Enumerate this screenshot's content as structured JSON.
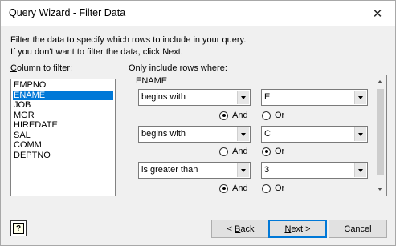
{
  "window": {
    "title": "Query Wizard - Filter Data",
    "close_glyph": "✕"
  },
  "intro": {
    "line1": "Filter the data to specify which rows to include in your query.",
    "line2": "If you don't want to filter the data, click Next."
  },
  "columns_label": {
    "mnemonic": "C",
    "rest": "olumn to filter:"
  },
  "columns": [
    "EMPNO",
    "ENAME",
    "JOB",
    "MGR",
    "HIREDATE",
    "SAL",
    "COMM",
    "DEPTNO"
  ],
  "selected_column": "ENAME",
  "criteria_label": "Only include rows where:",
  "criteria_group": "ENAME",
  "conditions": [
    {
      "operator": "begins with",
      "value": "E",
      "logic": "And"
    },
    {
      "operator": "begins with",
      "value": "C",
      "logic": "Or"
    },
    {
      "operator": "is greater than",
      "value": "3",
      "logic": "And"
    }
  ],
  "logic_options": {
    "and": "And",
    "or": "Or"
  },
  "buttons": {
    "help_glyph": "?",
    "back": {
      "mnemonic": "B",
      "rest_before": "< ",
      "rest_after": "ack"
    },
    "next": {
      "mnemonic": "N",
      "rest_after": "ext >"
    },
    "cancel": "Cancel"
  },
  "colors": {
    "selection": "#0078d7",
    "default_button_border": "#0078d7"
  }
}
